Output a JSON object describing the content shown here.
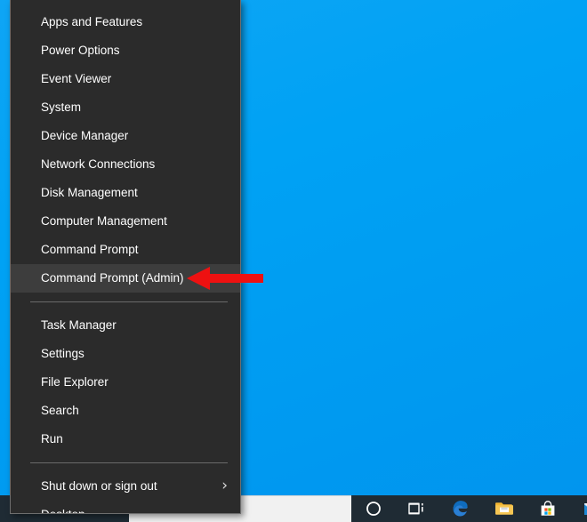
{
  "desktop": {
    "wallpaper_color_top": "#0fa5f5",
    "wallpaper_color_bottom": "#0195ee"
  },
  "winx_menu": {
    "name": "Power User Menu",
    "background_color": "#2b2b2b",
    "selected_background_color": "#3d3d3d",
    "text_color": "#ffffff",
    "selected_item": "Command Prompt (Admin)",
    "groups": [
      {
        "items": [
          {
            "label": "Apps and Features",
            "submenu": false
          },
          {
            "label": "Power Options",
            "submenu": false
          },
          {
            "label": "Event Viewer",
            "submenu": false
          },
          {
            "label": "System",
            "submenu": false
          },
          {
            "label": "Device Manager",
            "submenu": false
          },
          {
            "label": "Network Connections",
            "submenu": false
          },
          {
            "label": "Disk Management",
            "submenu": false
          },
          {
            "label": "Computer Management",
            "submenu": false
          },
          {
            "label": "Command Prompt",
            "submenu": false
          },
          {
            "label": "Command Prompt (Admin)",
            "submenu": false,
            "selected": true
          }
        ]
      },
      {
        "items": [
          {
            "label": "Task Manager",
            "submenu": false
          },
          {
            "label": "Settings",
            "submenu": false
          },
          {
            "label": "File Explorer",
            "submenu": false
          },
          {
            "label": "Search",
            "submenu": false
          },
          {
            "label": "Run",
            "submenu": false
          }
        ]
      },
      {
        "items": [
          {
            "label": "Shut down or sign out",
            "submenu": true,
            "chevron": "›"
          },
          {
            "label": "Desktop",
            "submenu": false
          }
        ]
      }
    ]
  },
  "annotation": {
    "arrow_color": "#ee1111",
    "points_at": "Command Prompt (Admin)",
    "direction": "left"
  },
  "taskbar": {
    "background_color": "#1f2b34",
    "search_box_color": "#f1f1f1",
    "icons": [
      {
        "name": "cortana-icon",
        "label": "Cortana"
      },
      {
        "name": "task-view-icon",
        "label": "Task View"
      },
      {
        "name": "edge-icon",
        "label": "Microsoft Edge"
      },
      {
        "name": "file-explorer-icon",
        "label": "File Explorer"
      },
      {
        "name": "microsoft-store-icon",
        "label": "Microsoft Store"
      },
      {
        "name": "mail-icon",
        "label": "Mail"
      }
    ]
  }
}
